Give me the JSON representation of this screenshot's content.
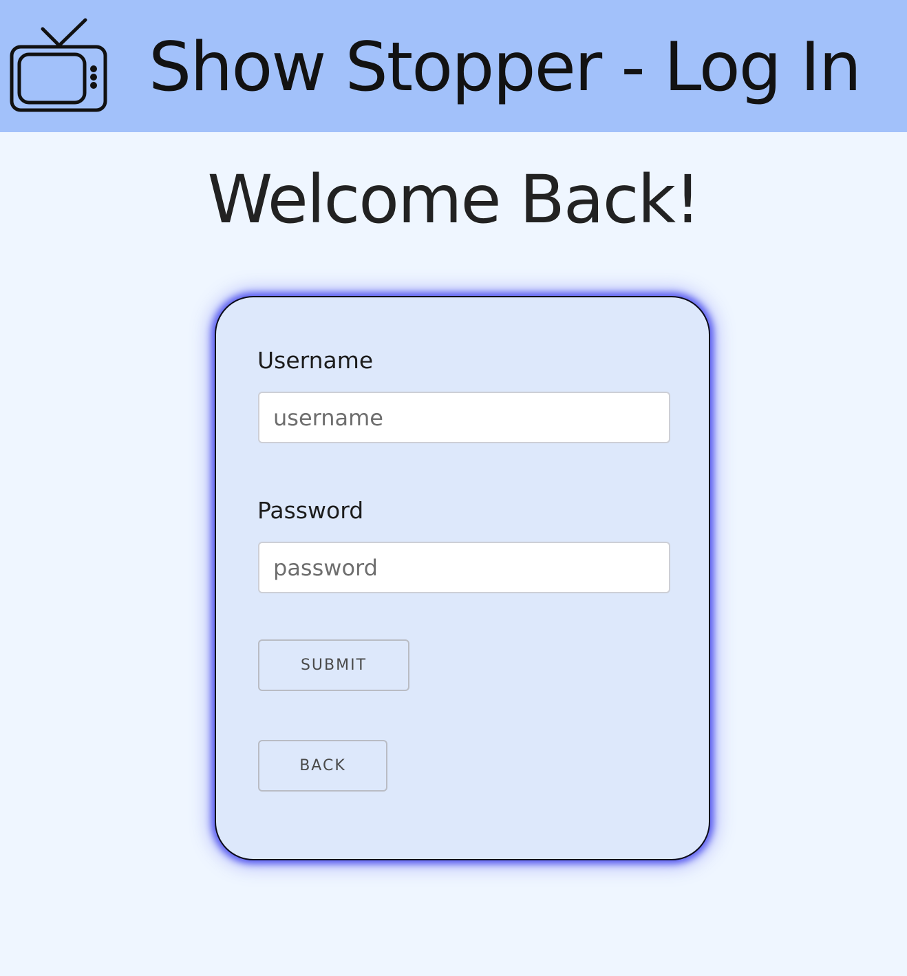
{
  "header": {
    "icon": "tv-icon",
    "title": "Show Stopper - Log In",
    "background_color": "#a2c1fa"
  },
  "main": {
    "heading": "Welcome Back!"
  },
  "login_form": {
    "username_label": "Username",
    "username_placeholder": "username",
    "username_value": "",
    "password_label": "Password",
    "password_placeholder": "password",
    "password_value": "",
    "submit_label": "SUBMIT",
    "back_label": "BACK",
    "card_glow_color": "#5b5ef0"
  }
}
